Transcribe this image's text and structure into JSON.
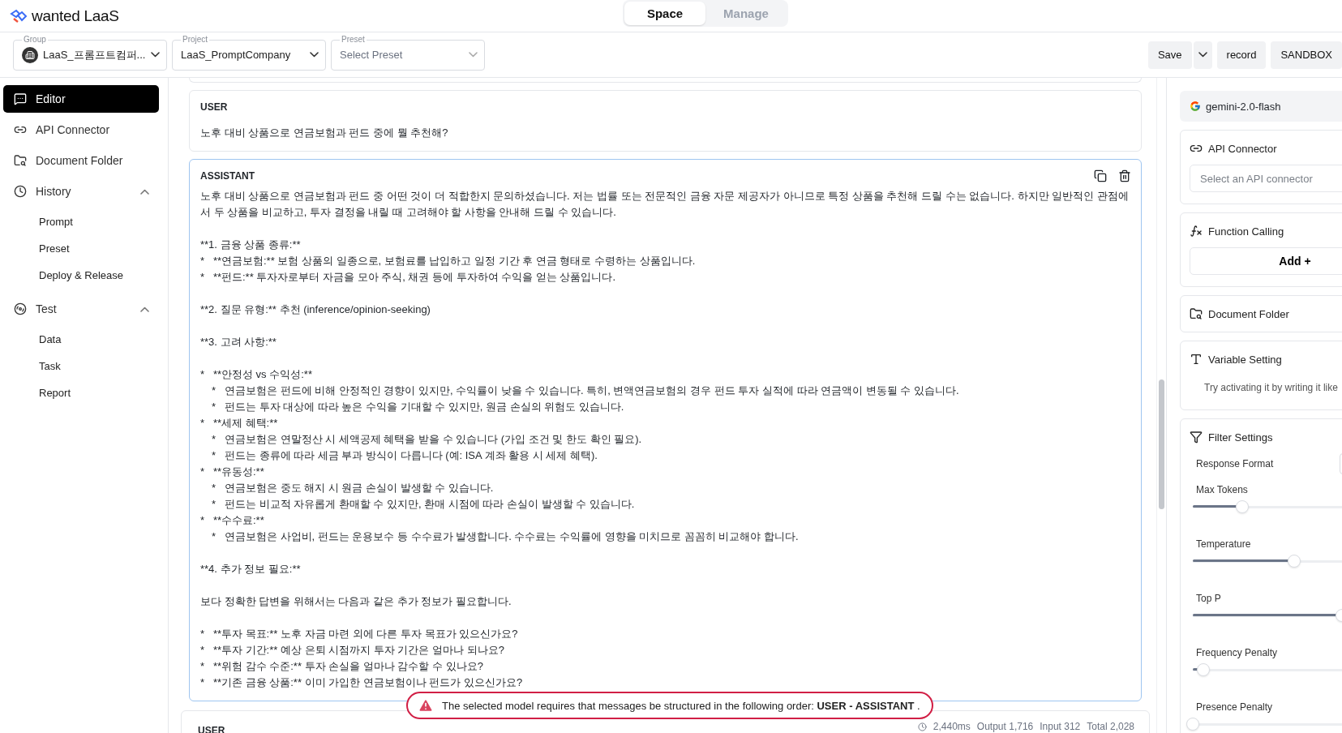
{
  "app": {
    "logo": "wanted LaaS"
  },
  "mode_tabs": [
    {
      "label": "Space",
      "selected": true
    },
    {
      "label": "Manage",
      "selected": false
    }
  ],
  "selectors": [
    {
      "label": "Group",
      "value": "LaaS_프롬프트컴퍼...",
      "kind": "group"
    },
    {
      "label": "Project",
      "value": "LaaS_PromptCompany",
      "kind": "plain"
    },
    {
      "label": "Preset",
      "placeholder": "Select Preset",
      "kind": "plain"
    }
  ],
  "toolbar_buttons": [
    {
      "kind": "text",
      "label": "Save"
    },
    {
      "kind": "caret"
    },
    {
      "kind": "text",
      "label": "record"
    },
    {
      "kind": "text",
      "label": "SANDBOX"
    }
  ],
  "sidebar": {
    "items": [
      {
        "label": "Editor",
        "selected": true
      },
      {
        "label": "API Connector",
        "selected": false
      },
      {
        "label": "Document Folder",
        "selected": false
      },
      {
        "label": "History",
        "selected": false,
        "expanded": true,
        "children": [
          {
            "label": "Prompt",
            "selected": false
          },
          {
            "label": "Preset",
            "selected": false
          },
          {
            "label": "Deploy & Release",
            "selected": false
          }
        ]
      },
      {
        "label": "Test",
        "selected": false,
        "expanded": true,
        "children": [
          {
            "label": "Data",
            "selected": false
          },
          {
            "label": "Task",
            "selected": false
          },
          {
            "label": "Report",
            "selected": false
          }
        ]
      }
    ]
  },
  "messages": [
    {
      "kind": "user",
      "role": "USER",
      "text": "노후 대비 상품으로 연금보험과 펀드 중에 뭘 추천해?"
    },
    {
      "kind": "assistant",
      "role": "ASSISTANT",
      "paragraphs": [
        {
          "lines": [
            {
              "kind": "head",
              "text": "노후 대비 상품으로 연금보험과 펀드 중 어떤 것이 더 적합한지 문의하셨습니다. 저는 법률 또는 전문적인 금융 자문 제공자가 아니므로 특정 상품을 추천해 드릴 수는 없습니다. 하지만 일반적인 관점에서 두 상품을 비교하고, 투자 결정을 내릴 때 고려해야 할 사항을 안내해 드릴 수 있습니다."
            }
          ]
        },
        {
          "lines": [
            {
              "kind": "head",
              "text": "**1. 금융 상품 종류:**"
            },
            {
              "kind": "item",
              "text": "*   **연금보험:** 보험 상품의 일종으로, 보험료를 납입하고 일정 기간 후 연금 형태로 수령하는 상품입니다."
            },
            {
              "kind": "item",
              "text": "*   **펀드:** 투자자로부터 자금을 모아 주식, 채권 등에 투자하여 수익을 얻는 상품입니다."
            }
          ]
        },
        {
          "lines": [
            {
              "kind": "head",
              "text": "**2. 질문 유형:** 추천 (inference/opinion-seeking)"
            }
          ]
        },
        {
          "lines": [
            {
              "kind": "head",
              "text": "**3. 고려 사항:**"
            }
          ]
        },
        {
          "lines": [
            {
              "kind": "item",
              "text": "*   **안정성 vs 수익성:**"
            },
            {
              "kind": "sub",
              "text": "*   연금보험은 펀드에 비해 안정적인 경향이 있지만, 수익률이 낮을 수 있습니다. 특히, 변액연금보험의 경우 펀드 투자 실적에 따라 연금액이 변동될 수 있습니다."
            },
            {
              "kind": "sub",
              "text": "*   펀드는 투자 대상에 따라 높은 수익을 기대할 수 있지만, 원금 손실의 위험도 있습니다."
            },
            {
              "kind": "item",
              "text": "*   **세제 혜택:**"
            },
            {
              "kind": "sub",
              "text": "*   연금보험은 연말정산 시 세액공제 혜택을 받을 수 있습니다 (가입 조건 및 한도 확인 필요)."
            },
            {
              "kind": "sub",
              "text": "*   펀드는 종류에 따라 세금 부과 방식이 다릅니다 (예: ISA 계좌 활용 시 세제 혜택)."
            },
            {
              "kind": "item",
              "text": "*   **유동성:**"
            },
            {
              "kind": "sub",
              "text": "*   연금보험은 중도 해지 시 원금 손실이 발생할 수 있습니다."
            },
            {
              "kind": "sub",
              "text": "*   펀드는 비교적 자유롭게 환매할 수 있지만, 환매 시점에 따라 손실이 발생할 수 있습니다."
            },
            {
              "kind": "item",
              "text": "*   **수수료:**"
            },
            {
              "kind": "sub",
              "text": "*   연금보험은 사업비, 펀드는 운용보수 등 수수료가 발생합니다. 수수료는 수익률에 영향을 미치므로 꼼꼼히 비교해야 합니다."
            }
          ]
        },
        {
          "lines": [
            {
              "kind": "head",
              "text": "**4. 추가 정보 필요:**"
            }
          ]
        },
        {
          "lines": [
            {
              "kind": "head",
              "text": "보다 정확한 답변을 위해서는 다음과 같은 추가 정보가 필요합니다."
            }
          ]
        },
        {
          "lines": [
            {
              "kind": "item",
              "text": "*   **투자 목표:** 노후 자금 마련 외에 다른 투자 목표가 있으신가요?"
            },
            {
              "kind": "item",
              "text": "*   **투자 기간:** 예상 은퇴 시점까지 투자 기간은 얼마나 되나요?"
            },
            {
              "kind": "item",
              "text": "*   **위험 감수 수준:** 투자 손실을 얼마나 감수할 수 있나요?"
            },
            {
              "kind": "item",
              "text": "*   **기존 금융 상품:** 이미 가입한 연금보험이나 펀드가 있으신가요?"
            }
          ]
        }
      ]
    },
    {
      "kind": "user_partial",
      "role": "USER",
      "stats": [
        "2,440ms",
        "Output 1,716",
        "Input 312",
        "Total 2,028"
      ]
    }
  ],
  "toast": {
    "text": "The selected model requires that messages be structured in the following order: **USER - ASSISTANT** ."
  },
  "right_panel": {
    "model": "gemini-2.0-flash",
    "api_connector": {
      "title": "API Connector",
      "placeholder": "Select an API connector"
    },
    "function_calling": {
      "title": "Function Calling",
      "button": "Add +"
    },
    "document_folder": {
      "title": "Document Folder"
    },
    "variable_setting": {
      "title": "Variable Setting",
      "hint": "Try activating it by writing it like"
    },
    "filter_settings": {
      "title": "Filter Settings",
      "response_format": "Response Format",
      "sliders": [
        {
          "label": "Max Tokens",
          "level": 0.33
        },
        {
          "label": "Temperature",
          "level": 0.68
        },
        {
          "label": "Top P",
          "level": 1
        },
        {
          "label": "Frequency Penalty",
          "level": 0.07
        },
        {
          "label": "Presence Penalty",
          "level": 0
        }
      ]
    }
  }
}
